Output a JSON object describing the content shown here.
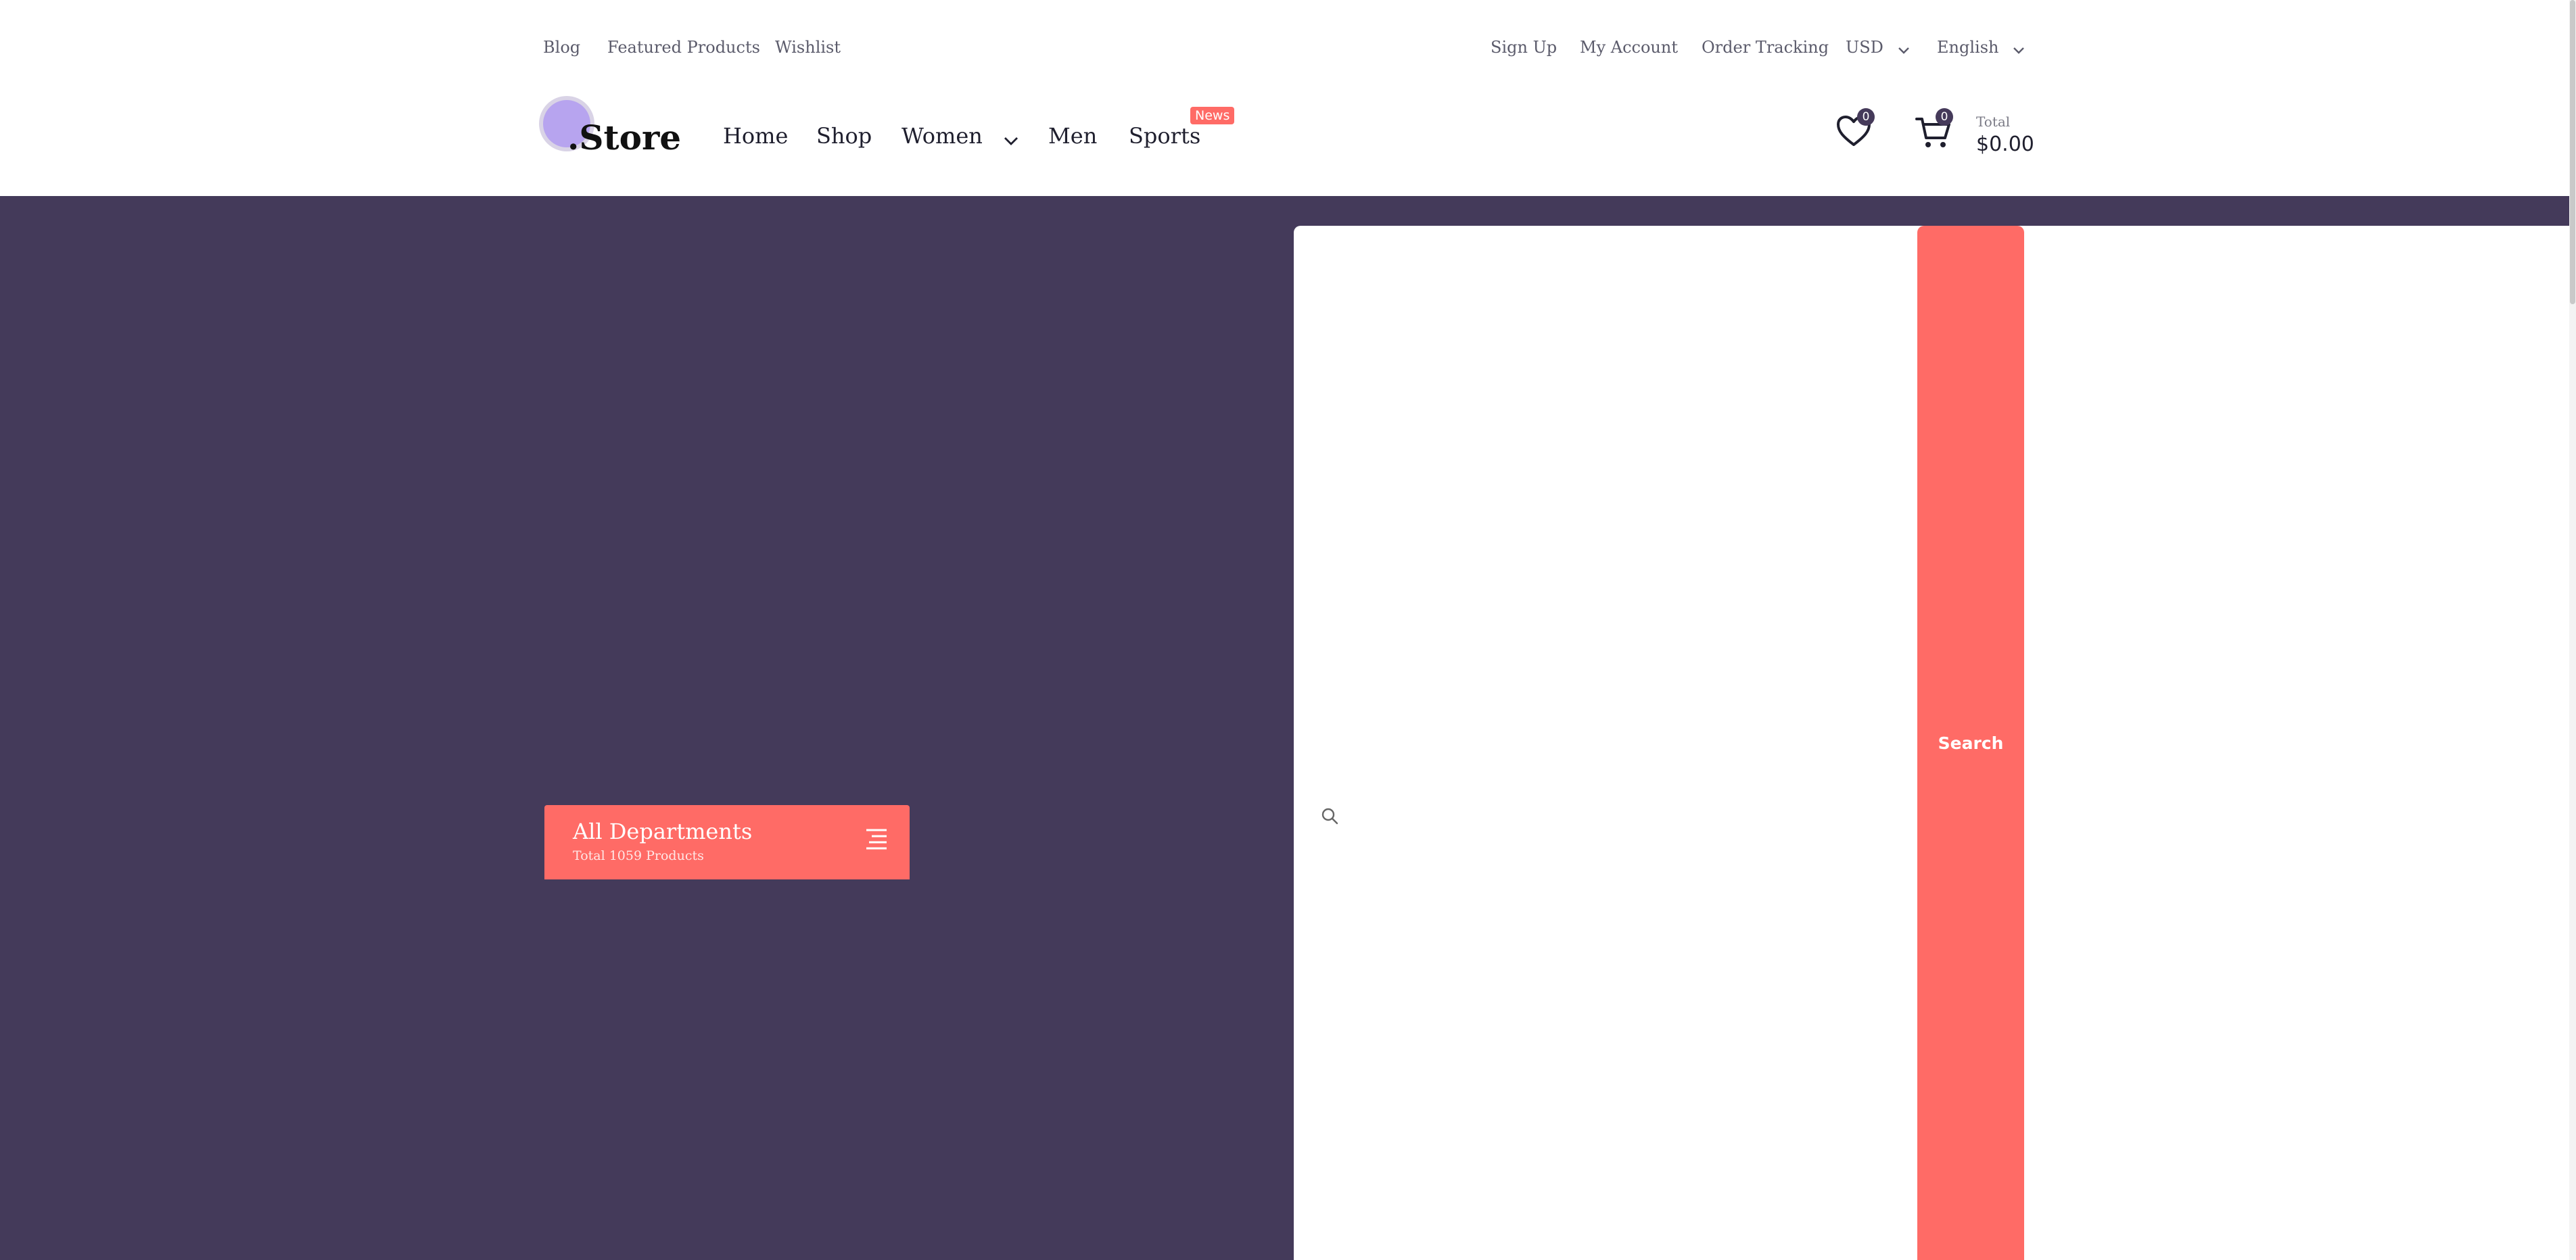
{
  "topbar": {
    "left_links": [
      "Blog",
      "Featured Products",
      "Wishlist"
    ],
    "right_links": [
      "Sign Up",
      "My Account",
      "Order Tracking"
    ],
    "currency": "USD",
    "language": "English"
  },
  "header": {
    "logo_text": ".Store",
    "nav": [
      "Home",
      "Shop",
      "Women",
      "Men",
      "Sports"
    ],
    "news_badge": "News",
    "wishlist_count": "0",
    "cart_count": "0",
    "total_label": "Total",
    "total_value": "$0.00"
  },
  "departments": {
    "title": "All Departments",
    "subtitle": "Total 1059 Products"
  },
  "search": {
    "placeholder": "",
    "button_label": "Search"
  },
  "colors": {
    "hero_bg": "#443a5a",
    "accent": "#ff6b66",
    "logo_dot": "#b7a4ef"
  },
  "icons": [
    "chevron-down-icon",
    "heart-icon",
    "cart-icon",
    "menu-icon",
    "search-icon"
  ]
}
